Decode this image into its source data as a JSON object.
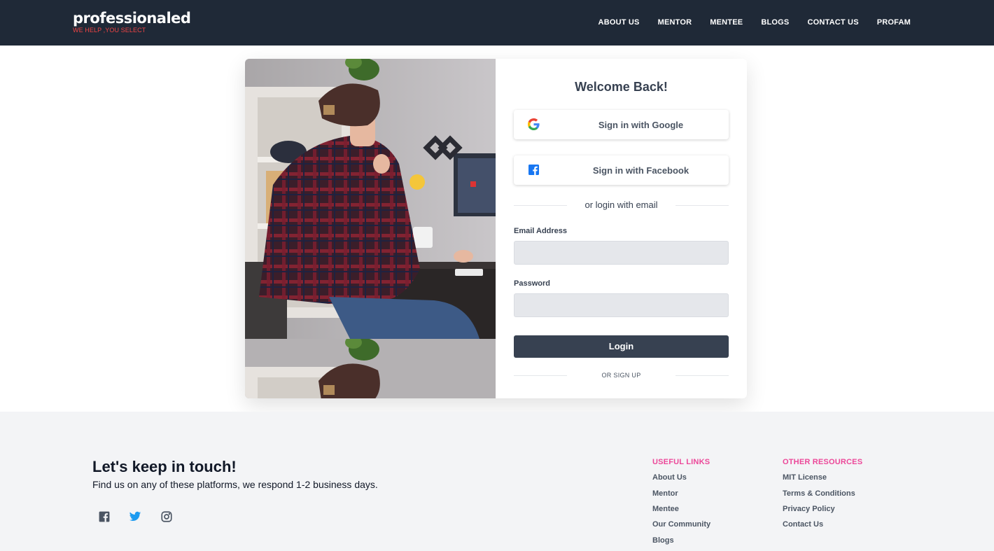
{
  "header": {
    "brand_name": "professionaled",
    "brand_tagline": "WE HELP ,YOU SELECT",
    "nav": [
      "ABOUT US",
      "MENTOR",
      "MENTEE",
      "BLOGS",
      "CONTACT US",
      "PROFAM"
    ]
  },
  "login": {
    "title": "Welcome Back!",
    "google_label": "Sign in with Google",
    "facebook_label": "Sign in with Facebook",
    "divider_email": "or login with email",
    "email_label": "Email Address",
    "email_value": "",
    "password_label": "Password",
    "password_value": "",
    "login_label": "Login",
    "signup_divider": "OR SIGN UP"
  },
  "footer": {
    "title": "Let's keep in touch!",
    "subtitle": "Find us on any of these platforms, we respond 1-2 business days.",
    "social_icons": [
      "facebook-icon",
      "twitter-icon",
      "instagram-icon"
    ],
    "useful_links_title": "USEFUL LINKS",
    "useful_links": [
      "About Us",
      "Mentor",
      "Mentee",
      "Our Community",
      "Blogs"
    ],
    "other_resources_title": "OTHER RESOURCES",
    "other_resources": [
      "MIT License",
      "Terms & Conditions",
      "Privacy Policy",
      "Contact Us"
    ]
  },
  "colors": {
    "header_bg": "#1f2937",
    "tagline": "#ef4444",
    "footer_heading": "#ec4899",
    "login_button": "#374151",
    "twitter": "#1d9bf0",
    "facebook_icon": "#1877f2"
  }
}
